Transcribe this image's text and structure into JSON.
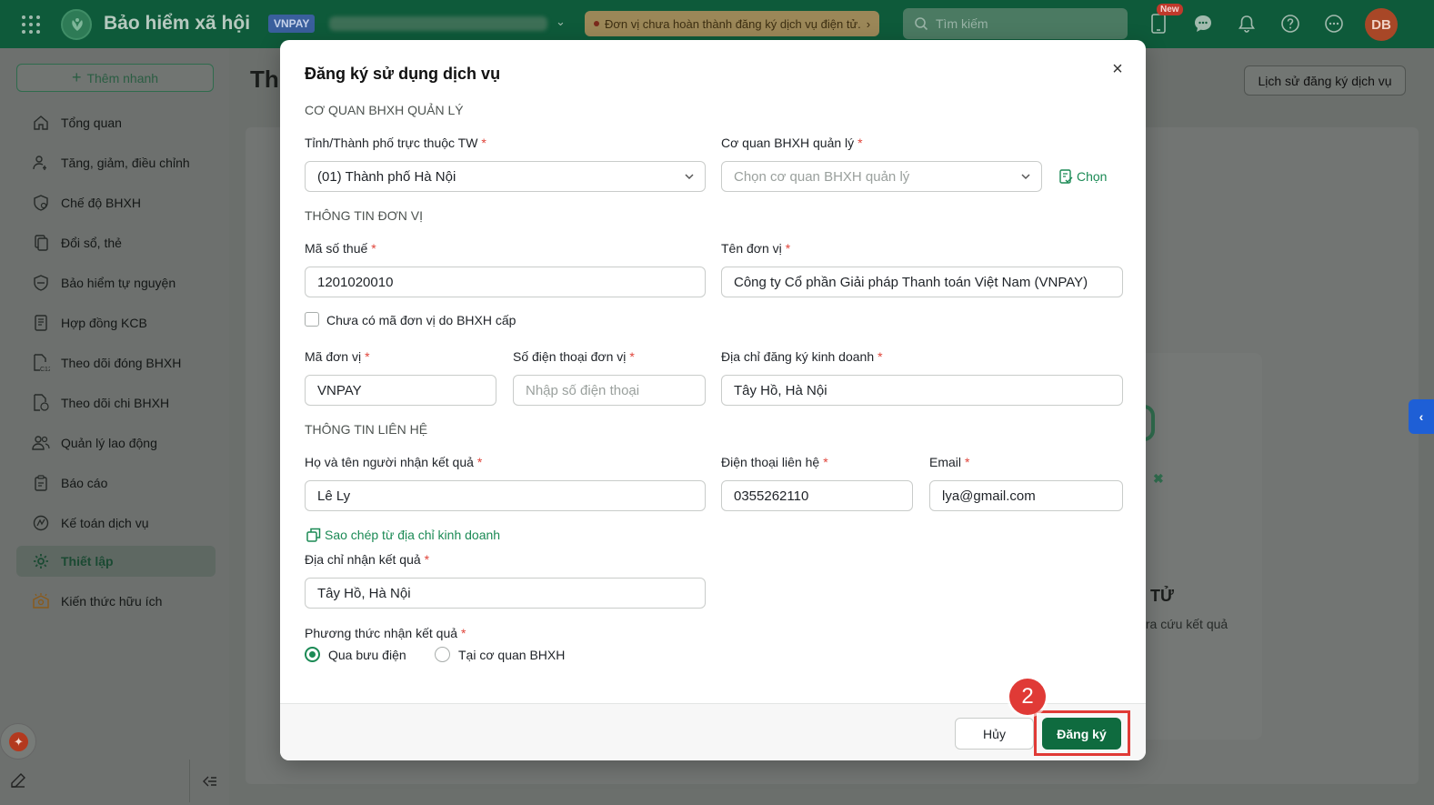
{
  "topbar": {
    "brand": "Bảo hiểm xã hội",
    "org_tag": "VNPAY",
    "alert": "Đơn vị chưa hoàn thành đăng ký dịch vụ điện tử.",
    "search_placeholder": "Tìm kiếm",
    "new_badge": "New",
    "avatar": "DB"
  },
  "sidebar": {
    "quick_add": "Thêm nhanh",
    "items": [
      {
        "label": "Tổng quan",
        "icon": "home-icon"
      },
      {
        "label": "Tăng, giảm, điều chỉnh",
        "icon": "user-adjust-icon"
      },
      {
        "label": "Chế độ BHXH",
        "icon": "shield-heart-icon"
      },
      {
        "label": "Đổi sổ, thẻ",
        "icon": "card-swap-icon"
      },
      {
        "label": "Bảo hiểm tự nguyện",
        "icon": "shield-icon"
      },
      {
        "label": "Hợp đồng KCB",
        "icon": "contract-icon"
      },
      {
        "label": "Theo dõi đóng BHXH",
        "icon": "document-c12-icon"
      },
      {
        "label": "Theo dõi chi BHXH",
        "icon": "document-money-icon"
      },
      {
        "label": "Quản lý lao động",
        "icon": "users-icon"
      },
      {
        "label": "Báo cáo",
        "icon": "clipboard-icon"
      },
      {
        "label": "Kế toán dịch vụ",
        "icon": "accounting-icon"
      },
      {
        "label": "Thiết lập",
        "icon": "gear-icon",
        "active": true
      },
      {
        "label": "Kiến thức hữu ích",
        "icon": "knowledge-icon"
      }
    ]
  },
  "main": {
    "title": "Th",
    "history_button": "Lịch sử đăng ký dịch vụ",
    "bg_heading": "TỬ",
    "bg_text": "tra cứu kết quả"
  },
  "modal": {
    "title": "Đăng ký sử dụng dịch vụ",
    "section_agency": "CƠ QUAN BHXH QUẢN LÝ",
    "province_label": "Tỉnh/Thành phố trực thuộc TW",
    "province_value": "(01) Thành phố Hà Nội",
    "agency_label": "Cơ quan BHXH quản lý",
    "agency_placeholder": "Chọn cơ quan BHXH quản lý",
    "choose_link": "Chọn",
    "section_unit": "THÔNG TIN ĐƠN VỊ",
    "tax_label": "Mã số thuế",
    "tax_value": "1201020010",
    "unit_name_label": "Tên đơn vị",
    "unit_name_value": "Công ty Cổ phần Giải pháp Thanh toán Việt Nam (VNPAY)",
    "no_code_checkbox": "Chưa có mã đơn vị do BHXH cấp",
    "unit_code_label": "Mã đơn vị",
    "unit_code_value": "VNPAY",
    "unit_phone_label": "Số điện thoại đơn vị",
    "unit_phone_placeholder": "Nhập số điện thoại",
    "business_addr_label": "Địa chỉ đăng ký kinh doanh",
    "business_addr_value": "Tây Hồ, Hà Nội",
    "section_contact": "THÔNG TIN LIÊN HỆ",
    "recipient_label": "Họ và tên người nhận kết quả",
    "recipient_value": "Lê Ly",
    "contact_phone_label": "Điện thoại liên hệ",
    "contact_phone_value": "0355262110",
    "email_label": "Email",
    "email_value": "lya@gmail.com",
    "copy_link": "Sao chép từ địa chỉ kinh doanh",
    "receive_addr_label": "Địa chỉ nhận kết quả",
    "receive_addr_value": "Tây Hồ, Hà Nội",
    "method_label": "Phương thức nhận kết quả",
    "method_options": [
      "Qua bưu điện",
      "Tại cơ quan BHXH"
    ],
    "method_selected": "Qua bưu điện",
    "cancel_button": "Hủy",
    "submit_button": "Đăng ký",
    "required_mark": "*"
  },
  "annotation": {
    "step": "2",
    "color": "#e03a36"
  },
  "colors": {
    "topbar": "#0e5a3a",
    "primary_green": "#0f6b3f",
    "link_green": "#1b8a55",
    "required_red": "#e0443a"
  }
}
